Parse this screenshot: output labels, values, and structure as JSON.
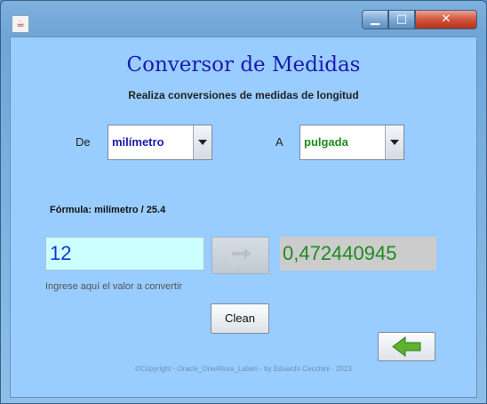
{
  "window": {
    "app_icon_glyph": "☕",
    "minimize_glyph": "▁",
    "maximize_glyph": "□",
    "close_glyph": "✕"
  },
  "header": {
    "title": "Conversor de Medidas",
    "subtitle": "Realiza conversiones de medidas de longitud"
  },
  "from": {
    "label": "De",
    "selected": "milímetro",
    "color": "#1a1ab0"
  },
  "to": {
    "label": "A",
    "selected": "pulgada",
    "color": "#1e8a20"
  },
  "formula": "Fórmula: milímetro / 25.4",
  "input": {
    "value": "12",
    "hint": "Ingrese aquí el valor a convertir"
  },
  "output": {
    "value": "0,472440945"
  },
  "buttons": {
    "clean_label": "Clean",
    "swap_icon": "swap-arrows-icon",
    "back_icon": "back-arrow-icon"
  },
  "footer": {
    "copyright": "©Copyright - Oracle_One/Alura_Latam  - by Eduardo Cecchini - 2023"
  }
}
